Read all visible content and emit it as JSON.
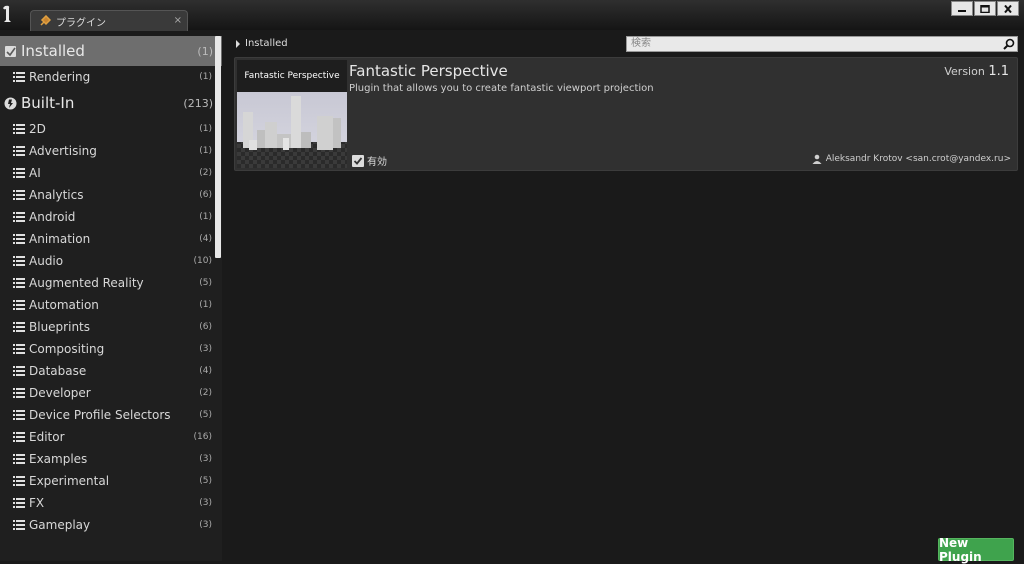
{
  "tab": {
    "title": "プラグイン",
    "close": "×"
  },
  "window_buttons": [
    "minimize-icon",
    "maximize-icon",
    "close-icon"
  ],
  "sidebar": {
    "installed": {
      "label": "Installed",
      "count": "(1)"
    },
    "installed_items": [
      {
        "label": "Rendering",
        "count": "(1)"
      }
    ],
    "builtin": {
      "label": "Built-In",
      "count": "(213)"
    },
    "builtin_items": [
      {
        "label": "2D",
        "count": "(1)"
      },
      {
        "label": "Advertising",
        "count": "(1)"
      },
      {
        "label": "AI",
        "count": "(2)"
      },
      {
        "label": "Analytics",
        "count": "(6)"
      },
      {
        "label": "Android",
        "count": "(1)"
      },
      {
        "label": "Animation",
        "count": "(4)"
      },
      {
        "label": "Audio",
        "count": "(10)"
      },
      {
        "label": "Augmented Reality",
        "count": "(5)"
      },
      {
        "label": "Automation",
        "count": "(1)"
      },
      {
        "label": "Blueprints",
        "count": "(6)"
      },
      {
        "label": "Compositing",
        "count": "(3)"
      },
      {
        "label": "Database",
        "count": "(4)"
      },
      {
        "label": "Developer",
        "count": "(2)"
      },
      {
        "label": "Device Profile Selectors",
        "count": "(5)"
      },
      {
        "label": "Editor",
        "count": "(16)"
      },
      {
        "label": "Examples",
        "count": "(3)"
      },
      {
        "label": "Experimental",
        "count": "(5)"
      },
      {
        "label": "FX",
        "count": "(3)"
      },
      {
        "label": "Gameplay",
        "count": "(3)"
      }
    ]
  },
  "breadcrumb": "Installed",
  "search": {
    "placeholder": "検索"
  },
  "plugin": {
    "thumb_title": "Fantastic Perspective",
    "name": "Fantastic Perspective",
    "description": "Plugin that allows you to create fantastic viewport projection",
    "version_label": "Version",
    "version_number": "1.1",
    "enabled_label": "有効",
    "enabled": true,
    "author": "Aleksandr Krotov <san.crot@yandex.ru>"
  },
  "new_plugin_button": "New Plugin",
  "colors": {
    "accent_green": "#3fa34d",
    "selected_row": "#6e6e6e"
  }
}
